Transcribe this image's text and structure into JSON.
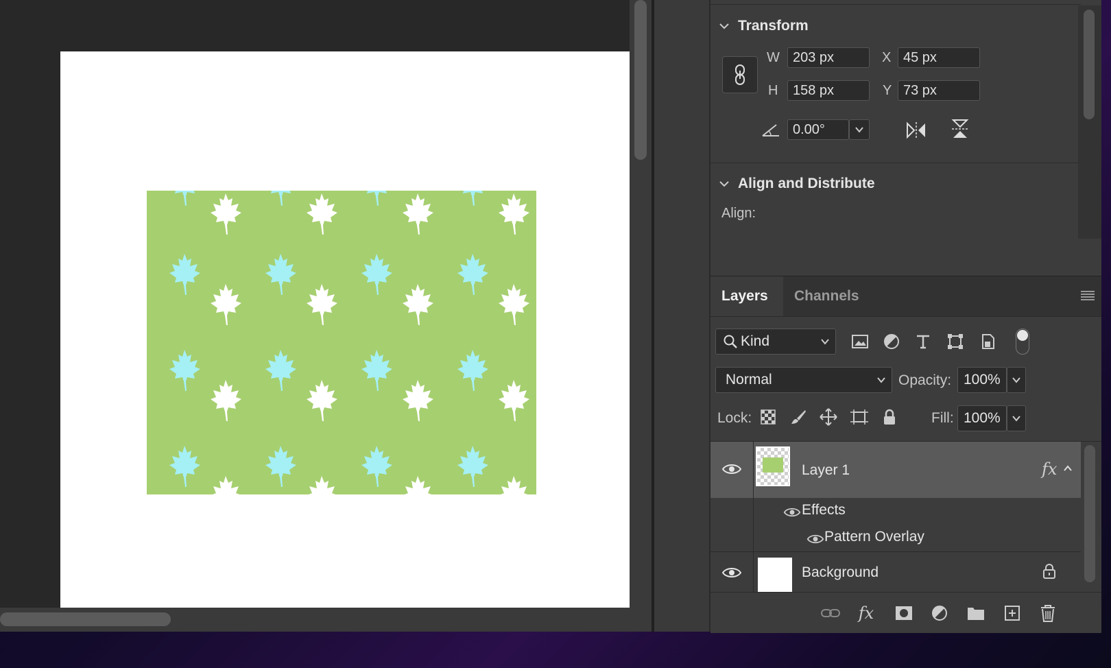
{
  "properties": {
    "transform_title": "Transform",
    "w_label": "W",
    "w_value": "203 px",
    "h_label": "H",
    "h_value": "158 px",
    "x_label": "X",
    "x_value": "45 px",
    "y_label": "Y",
    "y_value": "73 px",
    "angle_value": "0.00°",
    "align_title": "Align and Distribute",
    "align_label": "Align:"
  },
  "layers_panel": {
    "tabs": [
      {
        "label": "Layers",
        "active": true
      },
      {
        "label": "Channels",
        "active": false
      }
    ],
    "kind_label": "Kind",
    "blend_mode": "Normal",
    "opacity_label": "Opacity:",
    "opacity_value": "100%",
    "lock_label": "Lock:",
    "fill_label": "Fill:",
    "fill_value": "100%",
    "layers": [
      {
        "name": "Layer 1",
        "fx": "fx",
        "effects_label": "Effects",
        "effect_item": "Pattern Overlay"
      },
      {
        "name": "Background"
      }
    ]
  },
  "icons": {
    "link": "link-icon",
    "flip_h": "flip-horizontal-icon",
    "flip_v": "flip-vertical-icon",
    "filters": [
      "image-filter-icon",
      "adjustment-filter-icon",
      "type-filter-icon",
      "shape-filter-icon",
      "smart-object-filter-icon"
    ],
    "locks": [
      "lock-transparent-icon",
      "lock-image-icon",
      "lock-position-icon",
      "lock-artboard-icon",
      "lock-all-icon"
    ],
    "bottom": [
      "link-layers-icon",
      "add-style-icon",
      "add-mask-icon",
      "new-adjustment-icon",
      "new-group-icon",
      "new-layer-icon",
      "delete-layer-icon"
    ]
  },
  "colors": {
    "pattern_green": "#a6cf70",
    "leaf_cyan": "#a5f0f5",
    "leaf_white": "#ffffff"
  }
}
